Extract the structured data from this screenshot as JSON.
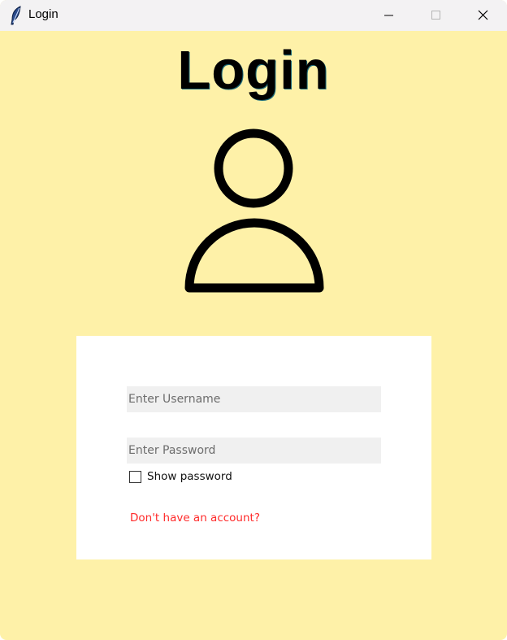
{
  "window": {
    "title": "Login",
    "app_icon": "feather-icon",
    "controls": [
      "minimize-icon",
      "maximize-icon",
      "close-icon"
    ]
  },
  "main": {
    "heading": "Login",
    "avatar_icon": "user-icon",
    "background_color": "#fef1a8"
  },
  "form": {
    "username_placeholder": "Enter Username",
    "username_value": "",
    "password_placeholder": "Enter Password",
    "password_value": "",
    "show_password_label": "Show password",
    "show_password_checked": false,
    "signup_link": "Don't have an account?",
    "link_color": "#ff2a2a",
    "card_color": "#ffffff",
    "field_color": "#f0f0f0"
  }
}
